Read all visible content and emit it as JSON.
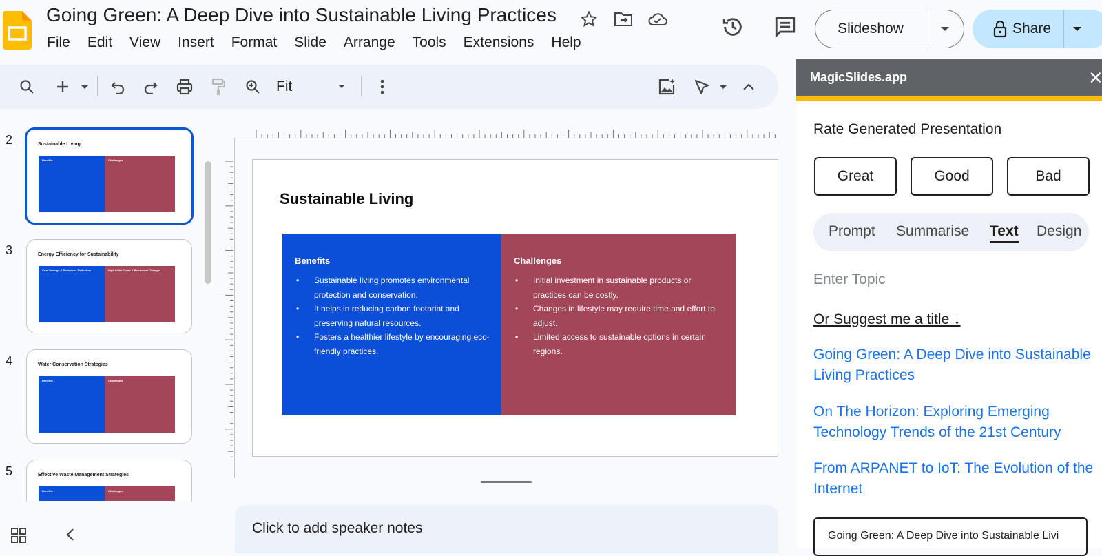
{
  "app": {
    "doc_title": "Going Green: A Deep Dive into Sustainable Living Practices"
  },
  "menu": [
    "File",
    "Edit",
    "View",
    "Insert",
    "Format",
    "Slide",
    "Arrange",
    "Tools",
    "Extensions",
    "Help"
  ],
  "header": {
    "slideshow_label": "Slideshow",
    "share_label": "Share"
  },
  "toolbar": {
    "zoom_value": "Fit"
  },
  "filmstrip": [
    {
      "num": "2",
      "title": "Sustainable Living",
      "left": "Benefits",
      "right": "Challenges"
    },
    {
      "num": "3",
      "title": "Energy Efficiency for Sustainability",
      "left": "Cost Savings & Emissions Reduction",
      "right": "High Initial Costs & Behavioral Changes"
    },
    {
      "num": "4",
      "title": "Water Conservation Strategies",
      "left": "Benefits",
      "right": "Challenges"
    },
    {
      "num": "5",
      "title": "Effective Waste Management Strategies",
      "left": "Benefits",
      "right": "Challenges"
    }
  ],
  "slide": {
    "title": "Sustainable Living",
    "left_heading": "Benefits",
    "left_items": [
      "Sustainable living promotes environmental protection and conservation.",
      "It helps in reducing carbon footprint and preserving natural resources.",
      "Fosters a healthier lifestyle by encouraging eco-friendly practices."
    ],
    "right_heading": "Challenges",
    "right_items": [
      "Initial investment in sustainable products or practices can be costly.",
      "Changes in lifestyle may require time and effort to adjust.",
      "Limited access to sustainable options in certain regions."
    ],
    "left_color": "#0b4fd8",
    "right_color": "#a3465a"
  },
  "notes": {
    "placeholder": "Click to add speaker notes"
  },
  "panel": {
    "title": "MagicSlides.app",
    "rate_heading": "Rate Generated Presentation",
    "rate_buttons": [
      "Great",
      "Good",
      "Bad"
    ],
    "tabs": [
      "Prompt",
      "Summarise",
      "Text",
      "Design"
    ],
    "active_tab": "Text",
    "topic_placeholder": "Enter Topic",
    "suggest_label": "Or Suggest me a title ↓",
    "suggestions": [
      "Going Green: A Deep Dive into Sustainable Living Practices",
      "On The Horizon: Exploring Emerging Technology Trends of the 21st Century",
      "From ARPANET to IoT: The Evolution of the Internet"
    ],
    "title_input_value": "Going Green: A Deep Dive into Sustainable Livi"
  }
}
